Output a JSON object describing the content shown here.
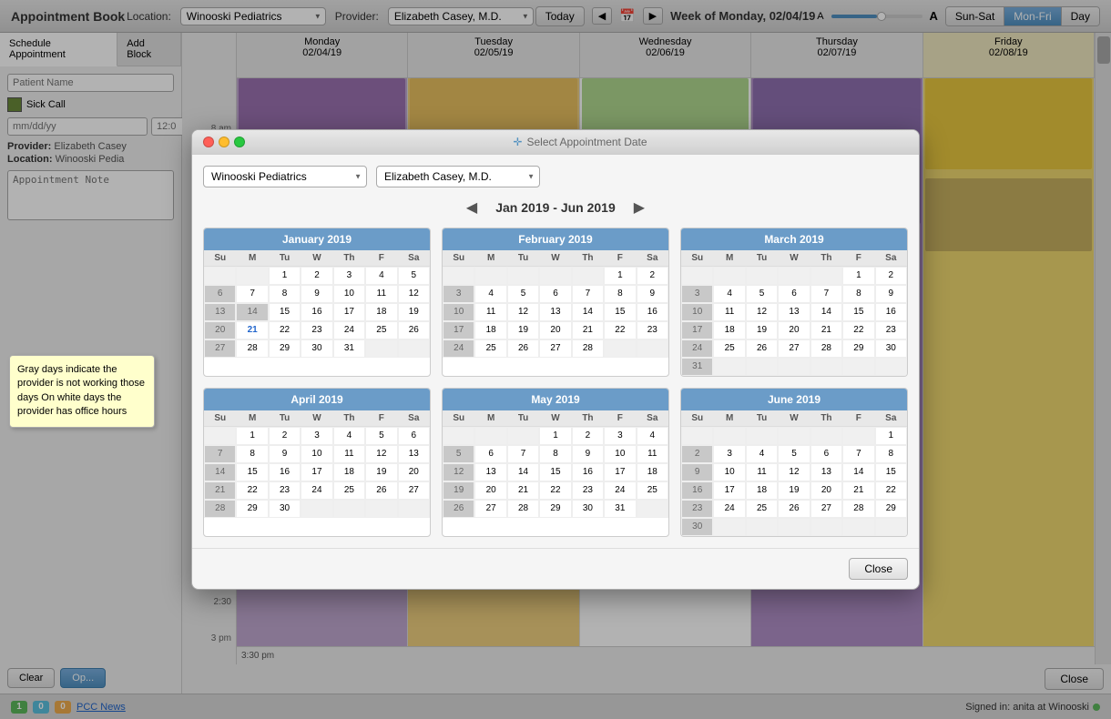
{
  "app": {
    "title": "Appointment Book",
    "location_label": "Location:",
    "provider_label": "Provider:",
    "location_value": "Winooski Pediatrics",
    "provider_value": "Elizabeth Casey, M.D.",
    "week_label": "Week of Monday, 02/04/19"
  },
  "header": {
    "today_btn": "Today",
    "view_tabs": [
      "Sun-Sat",
      "Mon-Fri",
      "Day"
    ],
    "active_tab": "Mon-Fri"
  },
  "left_panel": {
    "tabs": [
      "Schedule Appointment",
      "Add Block"
    ],
    "active_tab": "Schedule Appointment",
    "patient_name_label": "Patient Name",
    "patient_name_placeholder": "Patient Name",
    "sick_call_label": "Sick Call",
    "date_placeholder": "mm/dd/yy",
    "time_placeholder": "12:0",
    "provider_label": "Provider:",
    "provider_value": "Elizabeth Casey",
    "location_label": "Location:",
    "location_value": "Winooski Pedia",
    "note_label": "Appointment Note",
    "clear_btn": "Clear",
    "open_btn": "Op..."
  },
  "modal": {
    "title": "Select Appointment Date",
    "location_dropdown": "Winooski Pediatrics",
    "provider_dropdown": "Elizabeth Casey, M.D.",
    "month_range": "Jan 2019 - Jun 2019",
    "close_btn": "Close",
    "calendars": [
      {
        "name": "January 2019",
        "weeks": [
          [
            "",
            "",
            "1",
            "2",
            "3",
            "4",
            "5"
          ],
          [
            "6",
            "7",
            "8",
            "9",
            "10",
            "11",
            "12"
          ],
          [
            "13",
            "14",
            "15",
            "16",
            "17",
            "18",
            "19"
          ],
          [
            "20",
            "21",
            "22",
            "23",
            "24",
            "25",
            "26"
          ],
          [
            "27",
            "28",
            "29",
            "30",
            "31",
            "",
            ""
          ]
        ],
        "gray_days": [
          "6",
          "13",
          "14",
          "20",
          "27"
        ],
        "today_day": "21"
      },
      {
        "name": "February 2019",
        "weeks": [
          [
            "",
            "",
            "",
            "",
            "",
            "1",
            "2"
          ],
          [
            "3",
            "4",
            "5",
            "6",
            "7",
            "8",
            "9"
          ],
          [
            "10",
            "11",
            "12",
            "13",
            "14",
            "15",
            "16"
          ],
          [
            "17",
            "18",
            "19",
            "20",
            "21",
            "22",
            "23"
          ],
          [
            "24",
            "25",
            "26",
            "27",
            "28",
            "",
            ""
          ]
        ],
        "gray_days": [
          "3",
          "10",
          "17",
          "24"
        ],
        "today_day": ""
      },
      {
        "name": "March 2019",
        "weeks": [
          [
            "",
            "",
            "",
            "",
            "",
            "1",
            "2"
          ],
          [
            "3",
            "4",
            "5",
            "6",
            "7",
            "8",
            "9"
          ],
          [
            "10",
            "11",
            "12",
            "13",
            "14",
            "15",
            "16"
          ],
          [
            "17",
            "18",
            "19",
            "20",
            "21",
            "22",
            "23"
          ],
          [
            "24",
            "25",
            "26",
            "27",
            "28",
            "29",
            "30"
          ],
          [
            "31",
            "",
            "",
            "",
            "",
            "",
            ""
          ]
        ],
        "gray_days": [
          "3",
          "10",
          "17",
          "24",
          "31"
        ],
        "today_day": ""
      },
      {
        "name": "April 2019",
        "weeks": [
          [
            "",
            "1",
            "2",
            "3",
            "4",
            "5",
            "6"
          ],
          [
            "7",
            "8",
            "9",
            "10",
            "11",
            "12",
            "13"
          ],
          [
            "14",
            "15",
            "16",
            "17",
            "18",
            "19",
            "20"
          ],
          [
            "21",
            "22",
            "23",
            "24",
            "25",
            "26",
            "27"
          ],
          [
            "28",
            "29",
            "30",
            "",
            "",
            "",
            ""
          ]
        ],
        "gray_days": [
          "7",
          "14",
          "21",
          "28"
        ],
        "today_day": ""
      },
      {
        "name": "May 2019",
        "weeks": [
          [
            "",
            "",
            "",
            "1",
            "2",
            "3",
            "4"
          ],
          [
            "5",
            "6",
            "7",
            "8",
            "9",
            "10",
            "11"
          ],
          [
            "12",
            "13",
            "14",
            "15",
            "16",
            "17",
            "18"
          ],
          [
            "19",
            "20",
            "21",
            "22",
            "23",
            "24",
            "25"
          ],
          [
            "26",
            "27",
            "28",
            "29",
            "30",
            "31",
            ""
          ]
        ],
        "gray_days": [
          "5",
          "12",
          "19",
          "26"
        ],
        "today_day": ""
      },
      {
        "name": "June 2019",
        "weeks": [
          [
            "",
            "",
            "",
            "",
            "",
            "",
            "1"
          ],
          [
            "2",
            "3",
            "4",
            "5",
            "6",
            "7",
            "8"
          ],
          [
            "9",
            "10",
            "11",
            "12",
            "13",
            "14",
            "15"
          ],
          [
            "16",
            "17",
            "18",
            "19",
            "20",
            "21",
            "22"
          ],
          [
            "23",
            "24",
            "25",
            "26",
            "27",
            "28",
            "29"
          ],
          [
            "30",
            "",
            "",
            "",
            "",
            "",
            ""
          ]
        ],
        "gray_days": [
          "2",
          "9",
          "16",
          "23",
          "30"
        ],
        "today_day": ""
      }
    ]
  },
  "tooltip": {
    "text": "Gray days indicate the provider is not working those days On white days the provider has office hours"
  },
  "right_panel": {
    "friday_label": "Friday",
    "friday_date": "02/08/19"
  },
  "status_bar": {
    "badge1": "1",
    "badge2": "0",
    "badge3": "0",
    "news_link": "PCC News",
    "signed_in": "Signed in: anita at Winooski",
    "close_btn": "Close"
  },
  "day_headers": [
    {
      "label": "Monday",
      "date": "02/04/19"
    },
    {
      "label": "Tuesday",
      "date": "02/05/19"
    },
    {
      "label": "Wednesday",
      "date": "02/06/19"
    },
    {
      "label": "Thursday",
      "date": "02/07/19"
    },
    {
      "label": "Friday",
      "date": "02/08/19"
    }
  ],
  "time_slot": "3:30 pm"
}
